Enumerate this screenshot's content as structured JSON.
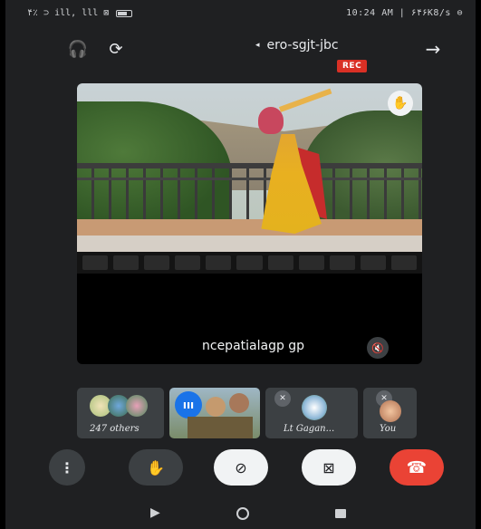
{
  "status_bar": {
    "left_text": "۴٪ ⊃ ill, lll ⊠",
    "time": "10:24 AM | ۶۴۶K8/s ⊖"
  },
  "call_header": {
    "meeting_code": "ero-sgjt-jbc",
    "caret": "◂",
    "rec_label": "REC",
    "headphones_icon": "🎧",
    "switch_camera_icon": "⟳",
    "back_icon": "→"
  },
  "main_tile": {
    "participant_name": "ncepatialagp gp",
    "mic_off_icon": "🔇",
    "raise_hand_icon": "✋"
  },
  "participants": [
    {
      "label": "247 others"
    },
    {
      "label": ""
    },
    {
      "label": "Lt Gagan..."
    },
    {
      "label": "You"
    }
  ],
  "controls": {
    "more_icon": "⋮",
    "hand_icon": "✋",
    "mic_icon": "⊘",
    "camera_icon": "⊠",
    "end_call_icon": "☎"
  },
  "colors": {
    "background": "#1f2022",
    "rec": "#d93025",
    "end_call": "#ea4335",
    "control_dark": "#3c4043",
    "control_light": "#f1f3f4"
  }
}
